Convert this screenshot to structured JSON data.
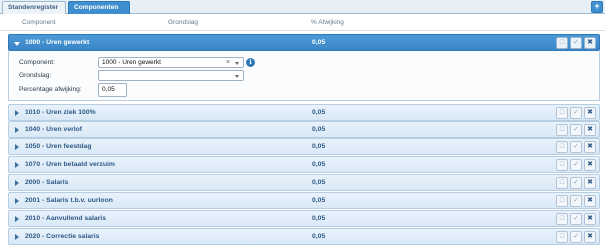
{
  "tabs": [
    {
      "label": "Standenregister",
      "active": false
    },
    {
      "label": "Componenten",
      "active": true
    }
  ],
  "add_tab_label": "+",
  "columns": {
    "component": "Component",
    "grondslag": "Grondslag",
    "afwijking": "% Afwijking"
  },
  "expanded": {
    "name": "1000 - Uren gewerkt",
    "pct": "0,05",
    "form": {
      "component_label": "Component:",
      "component_value": "1000 - Uren gewerkt",
      "grondslag_label": "Grondslag:",
      "grondslag_value": "",
      "percentage_label": "Percentage afwijking:",
      "percentage_value": "0,05"
    }
  },
  "rows": [
    {
      "name": "1010 - Uren ziek 100%",
      "pct": "0,05"
    },
    {
      "name": "1040 - Uren verlof",
      "pct": "0,05"
    },
    {
      "name": "1050 - Uren feestdag",
      "pct": "0,05"
    },
    {
      "name": "1070 - Uren betaald verzuim",
      "pct": "0,05"
    },
    {
      "name": "2000 - Salaris",
      "pct": "0,05"
    },
    {
      "name": "2001 - Salaris t.b.v. uurloon",
      "pct": "0,05"
    },
    {
      "name": "2010 - Aanvullend salaris",
      "pct": "0,05"
    },
    {
      "name": "2020 - Correctie salaris",
      "pct": "0,05"
    }
  ],
  "icons": {
    "save": "save-icon",
    "check": "check-icon",
    "delete": "delete-icon",
    "info": "info-icon",
    "clear": "clear-icon"
  },
  "colors": {
    "accent": "#3f8fd0",
    "row_bg": "#dfeaf6",
    "row_text": "#2d5a86"
  }
}
